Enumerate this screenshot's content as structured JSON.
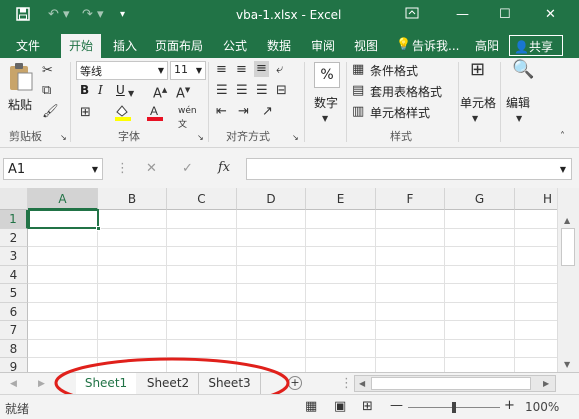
{
  "window": {
    "title": "vba-1.xlsx - Excel",
    "user": "高阳",
    "share_label": "共享",
    "tell_me": "告诉我..."
  },
  "tabs": [
    {
      "label": "文件"
    },
    {
      "label": "开始"
    },
    {
      "label": "插入"
    },
    {
      "label": "页面布局"
    },
    {
      "label": "公式"
    },
    {
      "label": "数据"
    },
    {
      "label": "审阅"
    },
    {
      "label": "视图"
    }
  ],
  "ribbon": {
    "clipboard": {
      "paste_label": "粘贴",
      "group_label": "剪贴板"
    },
    "font": {
      "name": "等线",
      "size": "11",
      "group_label": "字体",
      "bold": "B",
      "italic": "I",
      "underline": "U"
    },
    "alignment": {
      "group_label": "对齐方式"
    },
    "number": {
      "label": "数字",
      "symbol": "%"
    },
    "styles": {
      "conditional": "条件格式",
      "table": "套用表格格式",
      "cell_styles": "单元格样式",
      "group_label": "样式"
    },
    "cells": {
      "label": "单元格"
    },
    "editing": {
      "label": "编辑"
    }
  },
  "formula_bar": {
    "name_box": "A1",
    "fx": "fx",
    "formula": ""
  },
  "grid": {
    "columns": [
      "A",
      "B",
      "C",
      "D",
      "E",
      "F",
      "G",
      "H"
    ],
    "rows": [
      "1",
      "2",
      "3",
      "4",
      "5",
      "6",
      "7",
      "8",
      "9"
    ]
  },
  "sheets": [
    {
      "label": "Sheet1",
      "active": true
    },
    {
      "label": "Sheet2",
      "active": false
    },
    {
      "label": "Sheet3",
      "active": false
    }
  ],
  "status": {
    "ready": "就绪",
    "zoom": "100%"
  },
  "colors": {
    "accent": "#217346",
    "highlight_ring": "#e0201b"
  }
}
